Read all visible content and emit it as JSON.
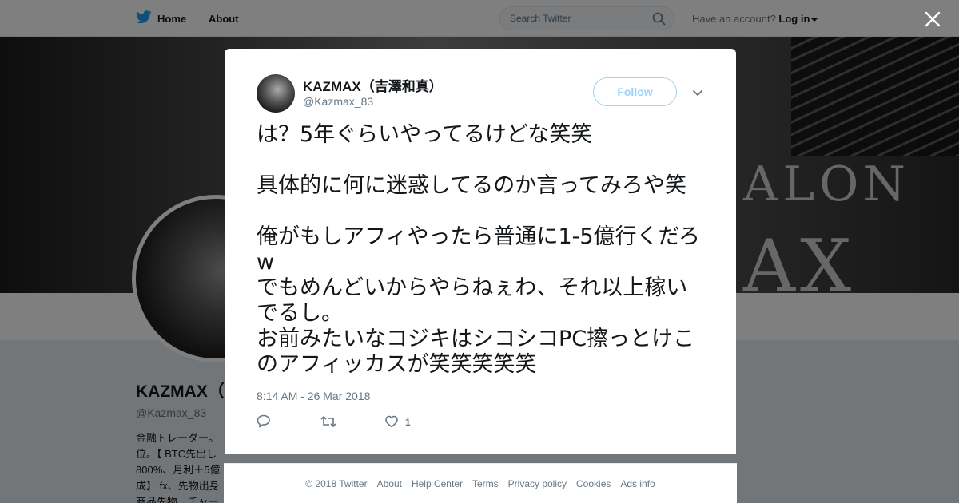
{
  "nav": {
    "home_label": "Home",
    "about_label": "About",
    "search_placeholder": "Search Twitter",
    "have_account": "Have an account?",
    "login_label": "Log in"
  },
  "banner": {
    "text_line1": "ALON",
    "text_line2": "AX"
  },
  "profile": {
    "name": "KAZMAX（",
    "handle": "@Kazmax_83",
    "bio_lines": [
      "金融トレーダー。",
      "位。【 BTC先出し",
      "800%、月利＋5億",
      "成】 fx、先物出身",
      "商品先物、チャー"
    ]
  },
  "tweet": {
    "author_name": "KAZMAX（吉澤和真）",
    "author_handle": "@Kazmax_83",
    "follow_label": "Follow",
    "lines": [
      "は？5年ぐらいやってるけどな笑笑",
      "",
      "具体的に何に迷惑してるのか言ってみろや笑",
      "",
      "俺がもしアフィやったら普通に1-5億行くだろw",
      "でもめんどいからやらねぇわ、それ以上稼いでるし。",
      "お前みたいなコジキはシコシコPC擦っとけこのアフィッカスが笑笑笑笑笑"
    ],
    "timestamp": "8:14 AM - 26 Mar 2018",
    "like_count": "1"
  },
  "footer": {
    "copyright": "© 2018 Twitter",
    "links": [
      "About",
      "Help Center",
      "Terms",
      "Privacy policy",
      "Cookies",
      "Ads info"
    ]
  },
  "colors": {
    "accent": "#1da1f2",
    "text_primary": "#14171a",
    "text_secondary": "#657786",
    "overlay": "rgba(0,0,0,0.5)"
  },
  "icons": {
    "logo": "twitter-bird-icon",
    "search": "search-icon",
    "close": "close-icon",
    "reply": "reply-icon",
    "retweet": "retweet-icon",
    "like": "heart-icon",
    "more": "chevron-down-icon"
  }
}
